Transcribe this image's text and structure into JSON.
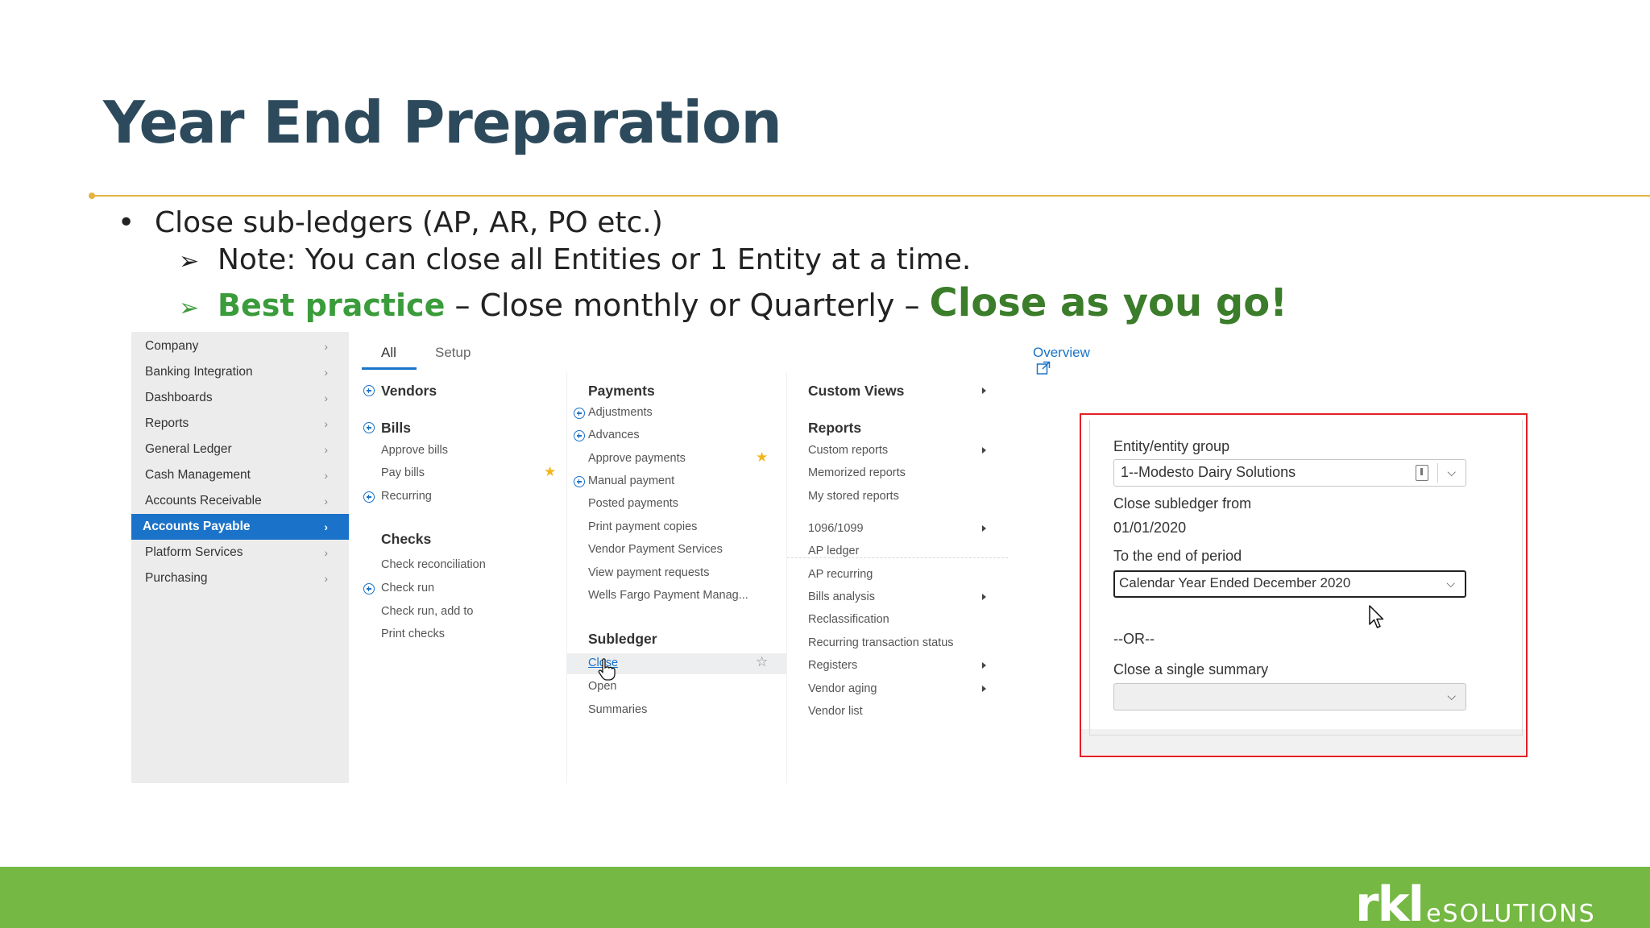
{
  "slide": {
    "title": "Year End Preparation",
    "bullet1": "Close sub-ledgers (AP, AR, PO etc.)",
    "bullet2": "Note:  You can close all Entities or 1 Entity at a time.",
    "bullet3_green": "Best practice",
    "bullet3_mid": " – Close monthly or Quarterly – ",
    "bullet3_big": "Close as you go!",
    "bullet_glyph": "•",
    "arrow_glyph": "➢"
  },
  "sidebar": {
    "items": [
      {
        "label": "Company"
      },
      {
        "label": "Banking Integration"
      },
      {
        "label": "Dashboards"
      },
      {
        "label": "Reports"
      },
      {
        "label": "General Ledger"
      },
      {
        "label": "Cash Management"
      },
      {
        "label": "Accounts Receivable"
      },
      {
        "label": "Accounts Payable",
        "active": true
      },
      {
        "label": "Platform Services"
      },
      {
        "label": "Purchasing"
      }
    ]
  },
  "tabs": {
    "all": "All",
    "setup": "Setup",
    "overview": "Overview"
  },
  "menu": {
    "vendors": "Vendors",
    "bills": "Bills",
    "approve_bills": "Approve bills",
    "pay_bills": "Pay bills",
    "recurring": "Recurring",
    "checks": "Checks",
    "check_reconciliation": "Check reconciliation",
    "check_run": "Check run",
    "check_run_add": "Check run, add to",
    "print_checks": "Print checks",
    "payments": "Payments",
    "adjustments": "Adjustments",
    "advances": "Advances",
    "approve_payments": "Approve payments",
    "manual_payment": "Manual payment",
    "posted_payments": "Posted payments",
    "print_payment_copies": "Print payment copies",
    "vendor_payment_services": "Vendor Payment Services",
    "view_payment_requests": "View payment requests",
    "wells_fargo": "Wells Fargo Payment Manag...",
    "subledger": "Subledger",
    "close": "Close",
    "open": "Open",
    "summaries": "Summaries",
    "custom_views": "Custom Views",
    "reports": "Reports",
    "custom_reports": "Custom reports",
    "memorized_reports": "Memorized reports",
    "my_stored_reports": "My stored reports",
    "r1096": "1096/1099",
    "ap_ledger": "AP ledger",
    "ap_recurring": "AP recurring",
    "bills_analysis": "Bills analysis",
    "reclassification": "Reclassification",
    "recurring_status": "Recurring transaction status",
    "registers": "Registers",
    "vendor_aging": "Vendor aging",
    "vendor_list": "Vendor list"
  },
  "form": {
    "entity_label": "Entity/entity group",
    "entity_value": "1--Modesto Dairy Solutions",
    "close_from_label": "Close subledger from",
    "close_from_value": "01/01/2020",
    "period_label": "To the end of period",
    "period_value": "Calendar Year Ended December 2020",
    "or_text": "--OR--",
    "summary_label": "Close a single summary",
    "summary_value": ""
  },
  "footer": {
    "logo_main": "rkl",
    "logo_sub": "eSOLUTIONS"
  },
  "colors": {
    "title": "#2c4a5c",
    "accent_blue": "#1a73c8",
    "green": "#3a9c3a",
    "footer_green": "#75b843",
    "highlight_red": "#e41f26",
    "rule_gold": "#e5b340"
  }
}
